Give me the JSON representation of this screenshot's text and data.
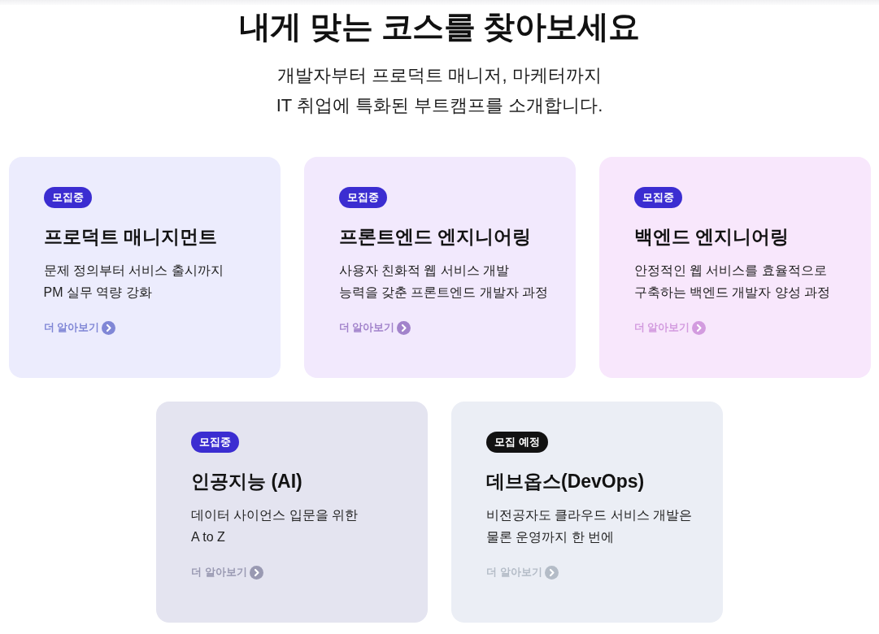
{
  "heading": "내게 맞는 코스를 찾아보세요",
  "intro_lines": [
    "개발자부터 프로덕트 매니저, 마케터까지",
    "IT 취업에 특화된 부트캠프를 소개합니다."
  ],
  "courses": [
    {
      "badge": {
        "kind": "open",
        "label": "모집중"
      },
      "title": "프로덕트 매니지먼트",
      "description_lines": [
        "문제 정의부터 서비스 출시까지",
        "PM 실무 역량 강화"
      ],
      "link": "더 알아보기"
    },
    {
      "badge": {
        "kind": "open",
        "label": "모집중"
      },
      "title": "프론트엔드 엔지니어링",
      "description_lines": [
        "사용자 친화적 웹 서비스 개발",
        "능력을 갖춘 프론트엔드 개발자 과정"
      ],
      "link": "더 알아보기"
    },
    {
      "badge": {
        "kind": "open",
        "label": "모집중"
      },
      "title": "백엔드 엔지니어링",
      "description_lines": [
        "안정적인 웹 서비스를 효율적으로",
        "구축하는 백엔드 개발자 양성 과정"
      ],
      "link": "더 알아보기"
    },
    {
      "badge": {
        "kind": "open",
        "label": "모집중"
      },
      "title": "인공지능 (AI)",
      "description_lines": [
        "데이터 사이언스 입문을 위한",
        "A to Z"
      ],
      "link": "더 알아보기"
    },
    {
      "badge": {
        "kind": "upcoming",
        "label": "모집 예정"
      },
      "title": "데브옵스(DevOps)",
      "description_lines": [
        "비전공자도 클라우드 서비스 개발은",
        "물론 운영까지 한 번에"
      ],
      "link": "더 알아보기"
    }
  ]
}
